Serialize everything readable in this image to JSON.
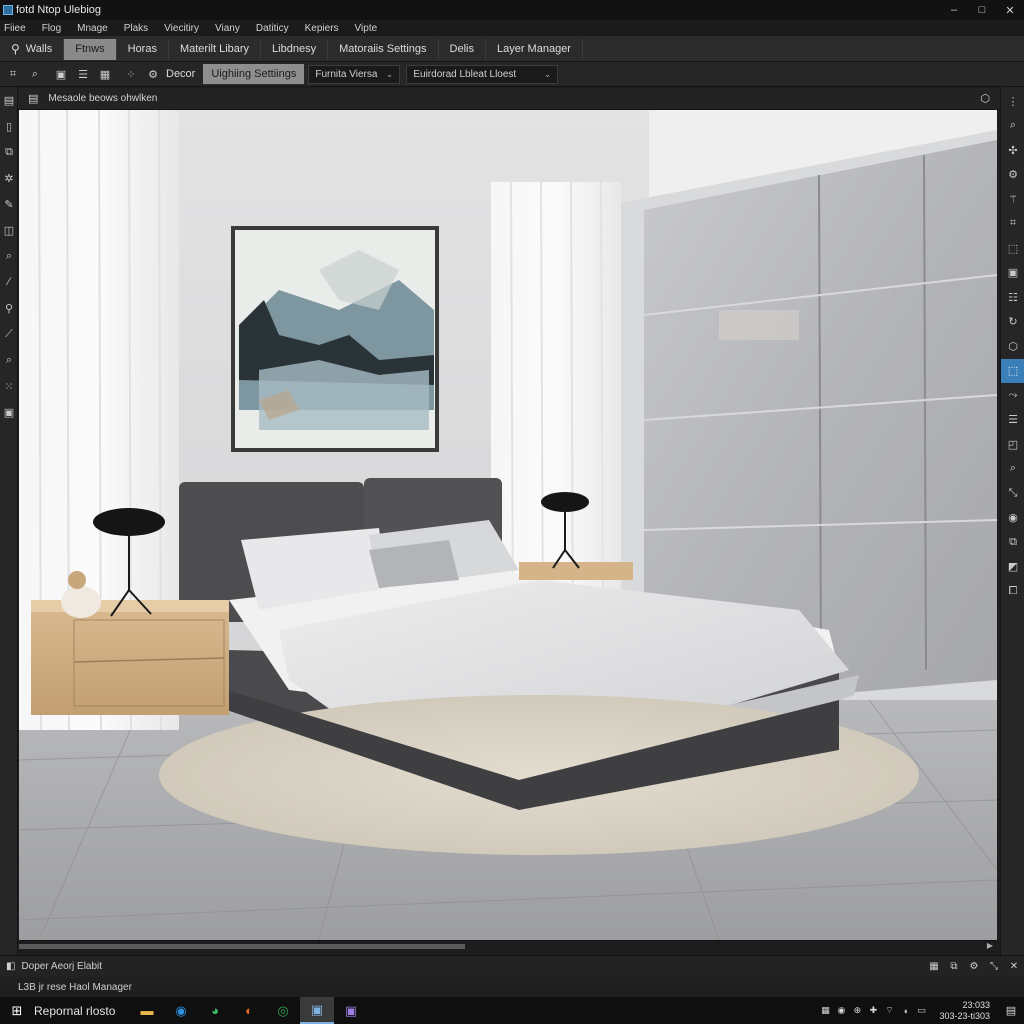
{
  "window": {
    "title": "fotd Ntop Ulebiog",
    "minimize": "–",
    "maximize": "□",
    "close": "✕"
  },
  "menu": [
    "Fiiee",
    "Flog",
    "Mnage",
    "Plaks",
    "Viecitiry",
    "Viany",
    "Datiticy",
    "Kepiers",
    "Vipte"
  ],
  "tabs": [
    {
      "label": "Walls",
      "active": false
    },
    {
      "label": "Ftnws",
      "active": true
    },
    {
      "label": "Horas",
      "active": false
    },
    {
      "label": "Materilt Libary",
      "active": false
    },
    {
      "label": "Libdnesy",
      "active": false
    },
    {
      "label": "Matoraiis Settings",
      "active": false
    },
    {
      "label": "Delis",
      "active": false
    },
    {
      "label": "Layer Manager",
      "active": false
    }
  ],
  "toolbar": {
    "decor_label": "Decor",
    "lighting_button": "Uighiing Settiings",
    "select1": "Furnita  Viersa",
    "select2": "Euirdorad  Lbleat  Lloest"
  },
  "panel": {
    "title": "Mesaole beows ohwlken",
    "expand_icon": "⬡"
  },
  "status": {
    "text": "Doper  Aeorj Elabit"
  },
  "bottom_panel": {
    "text": "L3B  jr rese Haol Manager"
  },
  "taskbar": {
    "search_text": "Repornal rlosto",
    "clock_time": "23:033",
    "clock_date": "303-23-ti303"
  },
  "colors": {
    "accent": "#3b7fb8",
    "active_tab": "#8a8a8a",
    "chrome_dark": "#1e1e1e"
  },
  "icons": {
    "left_rail": [
      "grid-icon",
      "document-icon",
      "layers-icon",
      "gear-icon",
      "pen-icon",
      "frame-icon",
      "search-icon",
      "pencil-icon",
      "pin-icon",
      "ruler-icon",
      "magnifier-icon",
      "nodes-icon",
      "box-icon"
    ],
    "right_rail": [
      "search-icon",
      "plus-icon",
      "gear-icon",
      "wand-icon",
      "crop-icon",
      "transform-icon",
      "image-icon",
      "table-icon",
      "rotate-icon",
      "cube-icon",
      "select-icon",
      "path-icon",
      "align-icon",
      "comment-icon",
      "zoom-icon",
      "dims-icon",
      "eye-icon",
      "copy-icon",
      "export-icon",
      "link-icon"
    ]
  }
}
